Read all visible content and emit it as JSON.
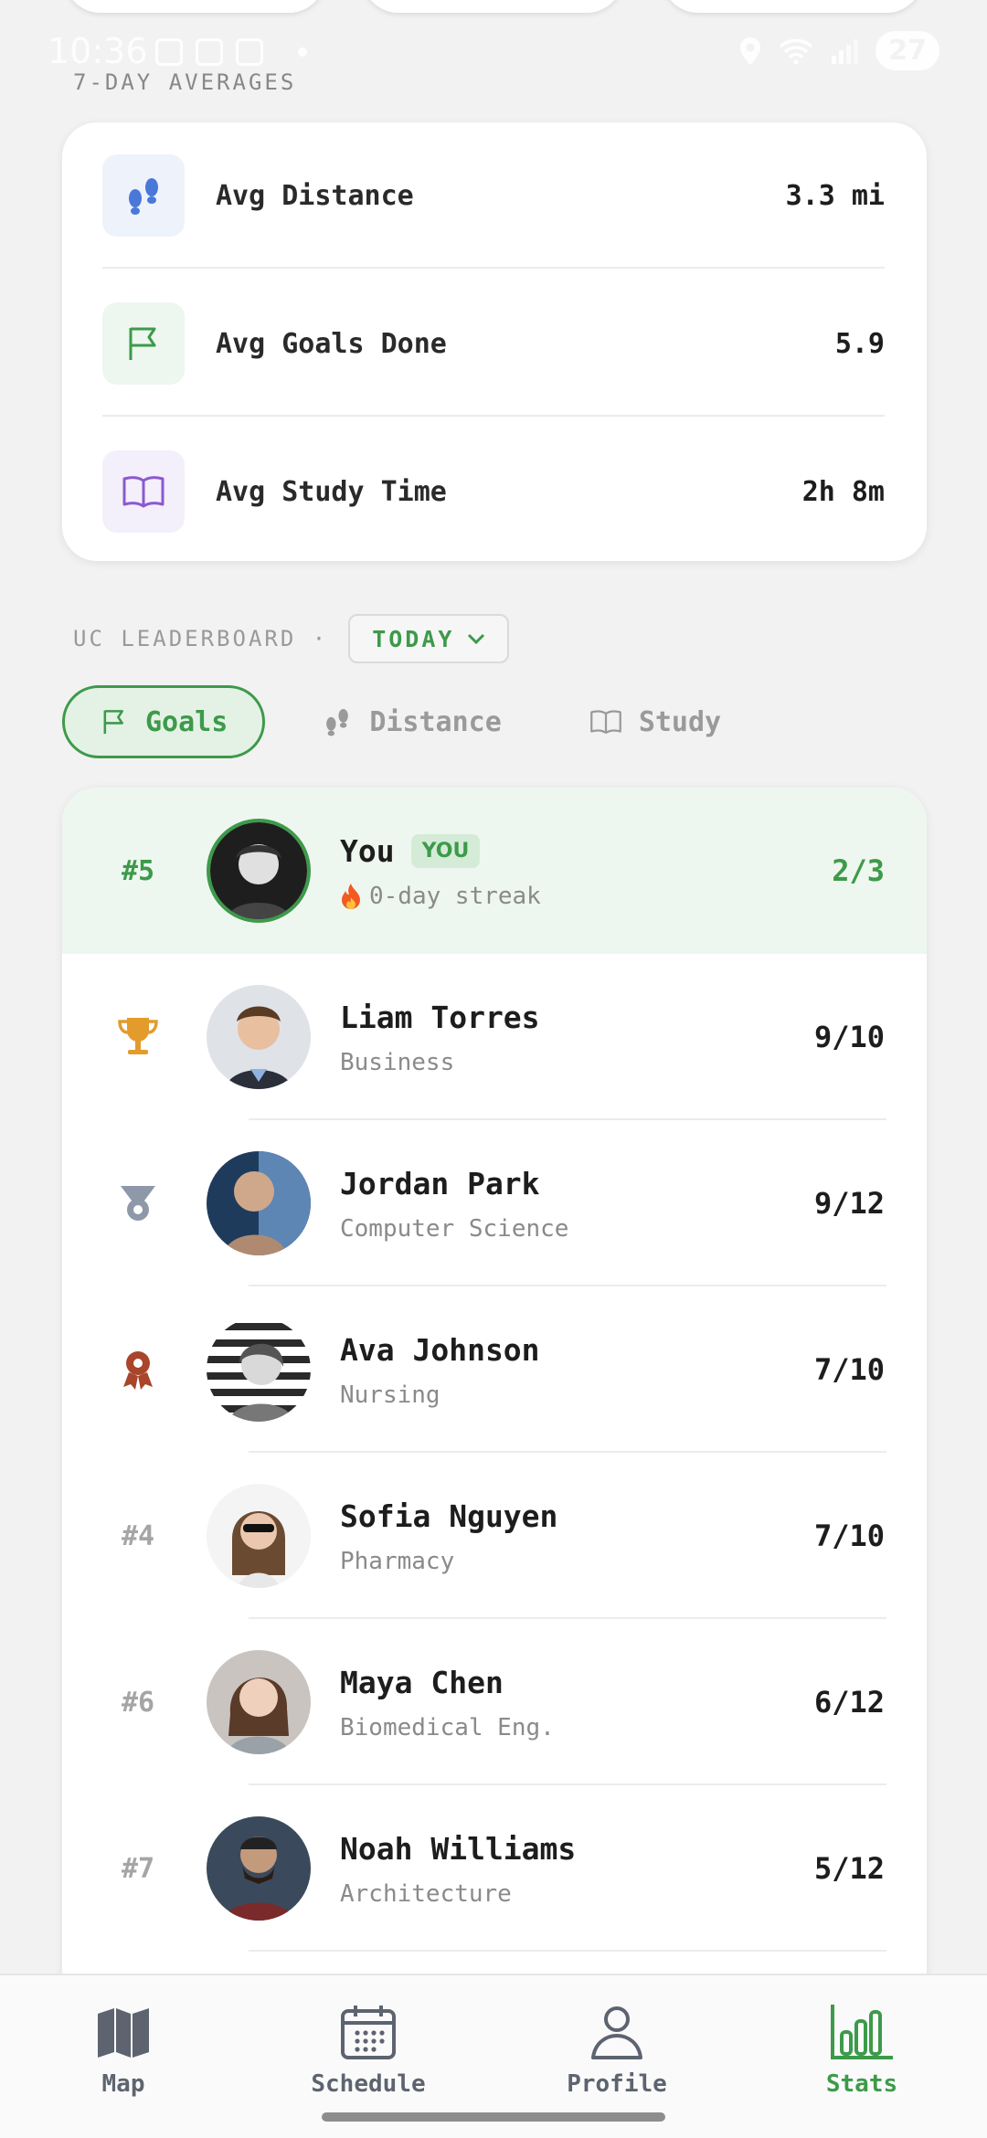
{
  "status_bar": {
    "time": "10:36",
    "battery": "27"
  },
  "averages": {
    "section_title": "7-DAY AVERAGES",
    "rows": [
      {
        "label": "Avg Distance",
        "value": "3.3 mi",
        "icon": "footprints-icon",
        "tint": "#eef2fb"
      },
      {
        "label": "Avg Goals Done",
        "value": "5.9",
        "icon": "flag-icon",
        "tint": "#edf6ef"
      },
      {
        "label": "Avg Study Time",
        "value": "2h 8m",
        "icon": "book-icon",
        "tint": "#f3effb"
      }
    ]
  },
  "leaderboard": {
    "title": "UC LEADERBOARD ·",
    "period": "TODAY",
    "tabs": [
      {
        "label": "Goals",
        "icon": "flag-icon",
        "active": true
      },
      {
        "label": "Distance",
        "icon": "footprints-icon",
        "active": false
      },
      {
        "label": "Study",
        "icon": "book-icon",
        "active": false
      }
    ],
    "me": {
      "rank": "#5",
      "name": "You",
      "badge": "YOU",
      "streak": "0-day streak",
      "score": "2/3"
    },
    "entries": [
      {
        "rank_icon": "trophy-icon",
        "name": "Liam Torres",
        "major": "Business",
        "score": "9/10"
      },
      {
        "rank_icon": "silver-medal-icon",
        "name": "Jordan Park",
        "major": "Computer Science",
        "score": "9/12"
      },
      {
        "rank_icon": "bronze-medal-icon",
        "name": "Ava Johnson",
        "major": "Nursing",
        "score": "7/10"
      },
      {
        "rank": "#4",
        "name": "Sofia Nguyen",
        "major": "Pharmacy",
        "score": "7/10"
      },
      {
        "rank": "#6",
        "name": "Maya Chen",
        "major": "Biomedical Eng.",
        "score": "6/12"
      },
      {
        "rank": "#7",
        "name": "Noah Williams",
        "major": "Architecture",
        "score": "5/12"
      }
    ]
  },
  "nav": [
    {
      "label": "Map",
      "icon": "map-icon",
      "active": false
    },
    {
      "label": "Schedule",
      "icon": "calendar-icon",
      "active": false
    },
    {
      "label": "Profile",
      "icon": "person-icon",
      "active": false
    },
    {
      "label": "Stats",
      "icon": "bar-chart-icon",
      "active": true
    }
  ],
  "colors": {
    "accent": "#3d9a4a",
    "background": "#f2f2f2",
    "gold": "#e39b2c",
    "silver": "#8e98a8",
    "bronze": "#a8452a"
  }
}
